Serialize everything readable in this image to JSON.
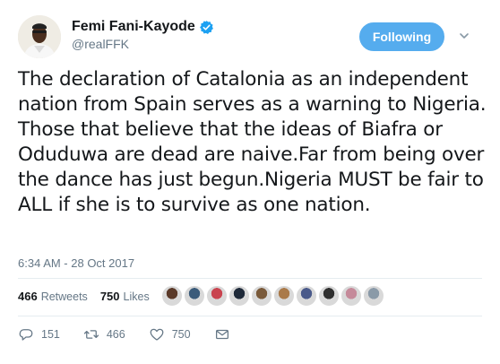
{
  "author": {
    "display_name": "Femi Fani-Kayode",
    "handle": "@realFFK",
    "verified": true
  },
  "follow_button": {
    "label": "Following"
  },
  "tweet": {
    "text": "The declaration of Catalonia as an independent nation from Spain serves as a warning to Nigeria. Those that believe that the ideas of Biafra or Oduduwa are dead are naive.Far from being over the dance has just begun.Nigeria MUST be fair to ALL if she is to survive as one nation.",
    "timestamp": "6:34 AM - 28 Oct 2017"
  },
  "stats": {
    "retweets_count": "466",
    "retweets_label": "Retweets",
    "likes_count": "750",
    "likes_label": "Likes"
  },
  "likers": [
    {
      "color": "#5b3a29"
    },
    {
      "color": "#3b5b7a"
    },
    {
      "color": "#c9444f"
    },
    {
      "color": "#1f2a3a"
    },
    {
      "color": "#7a5a3a"
    },
    {
      "color": "#aa7a4a"
    },
    {
      "color": "#4a5a8a"
    },
    {
      "color": "#2f2f2f"
    },
    {
      "color": "#c58a9a"
    },
    {
      "color": "#8a9aa8"
    }
  ],
  "actions": {
    "replies": "151",
    "retweets": "466",
    "likes": "750"
  },
  "colors": {
    "accent": "#55acee",
    "muted": "#657786",
    "divider": "#e6ecf0"
  }
}
